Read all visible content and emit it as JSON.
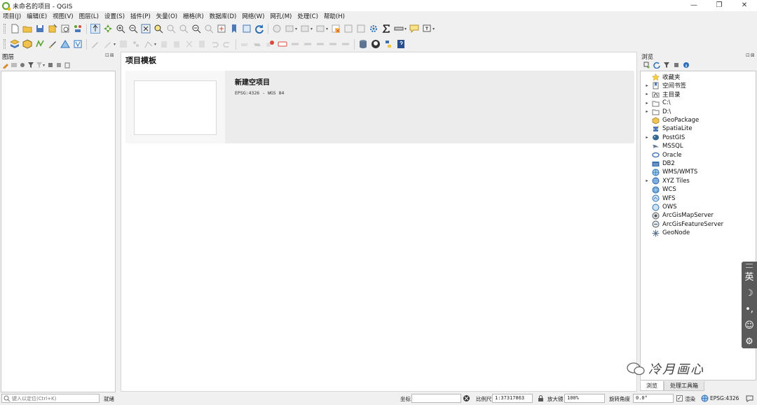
{
  "window": {
    "title": "未命名的项目 - QGIS",
    "minimize": "—",
    "maximize": "❐",
    "close": "✕"
  },
  "menu": [
    "项目(J)",
    "编辑(E)",
    "视图(V)",
    "图层(L)",
    "设置(S)",
    "插件(P)",
    "矢量(O)",
    "栅格(R)",
    "数据库(D)",
    "网络(W)",
    "网孔(M)",
    "处理(C)",
    "帮助(H)"
  ],
  "panels": {
    "layers_title": "图层",
    "browser_title": "浏览",
    "panel_controls": "⊡⊠"
  },
  "main": {
    "heading": "项目模板",
    "template_title": "新建空项目",
    "template_crs": "EPSG:4326 - WGS 84"
  },
  "browser_items": [
    {
      "label": "收藏夹",
      "expand": "",
      "icon": "star-icon"
    },
    {
      "label": "空间书签",
      "expand": "▸",
      "icon": "bookmark-icon"
    },
    {
      "label": "主目录",
      "expand": "▸",
      "icon": "home-folder-icon"
    },
    {
      "label": "C:\\",
      "expand": "▸",
      "icon": "folder-icon"
    },
    {
      "label": "D:\\",
      "expand": "▸",
      "icon": "folder-icon"
    },
    {
      "label": "GeoPackage",
      "expand": "",
      "icon": "geopackage-icon"
    },
    {
      "label": "SpatiaLite",
      "expand": "",
      "icon": "spatialite-icon"
    },
    {
      "label": "PostGIS",
      "expand": "▸",
      "icon": "postgis-icon"
    },
    {
      "label": "MSSQL",
      "expand": "",
      "icon": "mssql-icon"
    },
    {
      "label": "Oracle",
      "expand": "",
      "icon": "oracle-icon"
    },
    {
      "label": "DB2",
      "expand": "",
      "icon": "db2-icon"
    },
    {
      "label": "WMS/WMTS",
      "expand": "",
      "icon": "wms-icon"
    },
    {
      "label": "XYZ Tiles",
      "expand": "▸",
      "icon": "xyz-tiles-icon"
    },
    {
      "label": "WCS",
      "expand": "",
      "icon": "wcs-icon"
    },
    {
      "label": "WFS",
      "expand": "",
      "icon": "wfs-icon"
    },
    {
      "label": "OWS",
      "expand": "",
      "icon": "ows-icon"
    },
    {
      "label": "ArcGisMapServer",
      "expand": "",
      "icon": "arcgis-map-icon"
    },
    {
      "label": "ArcGisFeatureServer",
      "expand": "",
      "icon": "arcgis-feature-icon"
    },
    {
      "label": "GeoNode",
      "expand": "",
      "icon": "geonode-icon"
    }
  ],
  "bottom_tabs": [
    "浏览",
    "处理工具箱"
  ],
  "ime": {
    "lang": "英",
    "moon": "☽",
    "punct": "•,",
    "emoji": "☺",
    "settings": "⚙"
  },
  "watermark": "冷月画心",
  "status": {
    "locator_placeholder": "键入以定位(Ctrl+K)",
    "ready": "就绪",
    "coord_label": "坐标",
    "coord_value": "",
    "scale_label": "比例尺",
    "scale_value": "1:37317863",
    "magnifier_label": "放大镜",
    "magnifier_value": "100%",
    "rotation_label": "旋转角度",
    "rotation_value": "0.0°",
    "render_label": "渲染",
    "render_checked": "✓",
    "crs": "EPSG:4326"
  },
  "colors": {
    "qgis_green": "#5aa330",
    "qgis_yellow": "#f1b90f",
    "accent_blue": "#2a6fb8"
  }
}
